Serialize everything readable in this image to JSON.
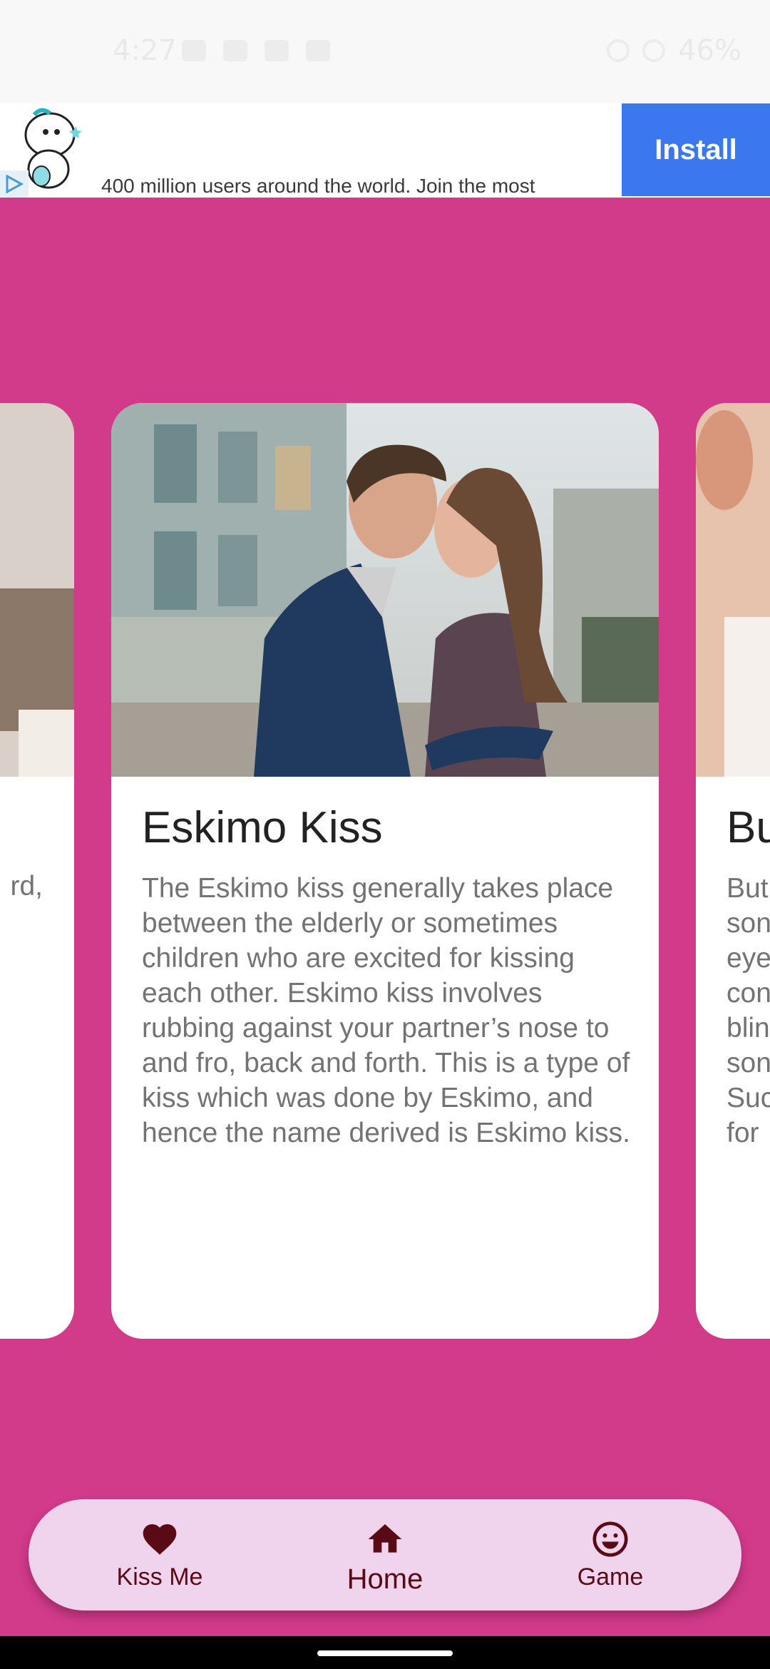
{
  "status_bar": {
    "time": "4:27",
    "battery": "46%"
  },
  "ad": {
    "text": "400 million users around the world. Join the most",
    "install_label": "Install"
  },
  "cards": {
    "left": {
      "body_fragment": "rd,"
    },
    "center": {
      "title": "Eskimo Kiss",
      "body": "The Eskimo kiss generally takes place between the elderly or sometimes children who are excited for kissing each other. Eskimo kiss involves rubbing against your partner’s nose to and fro, back and forth. This is a type of kiss which was done by Eskimo, and hence the name derived is Eskimo kiss."
    },
    "right": {
      "title_fragment": "Bu",
      "body_lines": [
        "But",
        "son",
        "eye",
        "con",
        "blin",
        "son",
        "Suc",
        "for"
      ]
    }
  },
  "bottom_nav": {
    "items": [
      {
        "label": "Kiss Me",
        "icon": "heart-icon"
      },
      {
        "label": "Home",
        "icon": "home-icon",
        "active": true
      },
      {
        "label": "Game",
        "icon": "smile-icon"
      }
    ]
  },
  "colors": {
    "background": "#d23a8a",
    "nav_background": "#f0d3ec",
    "nav_icon": "#5a0a14",
    "install_button": "#3b77ee"
  }
}
